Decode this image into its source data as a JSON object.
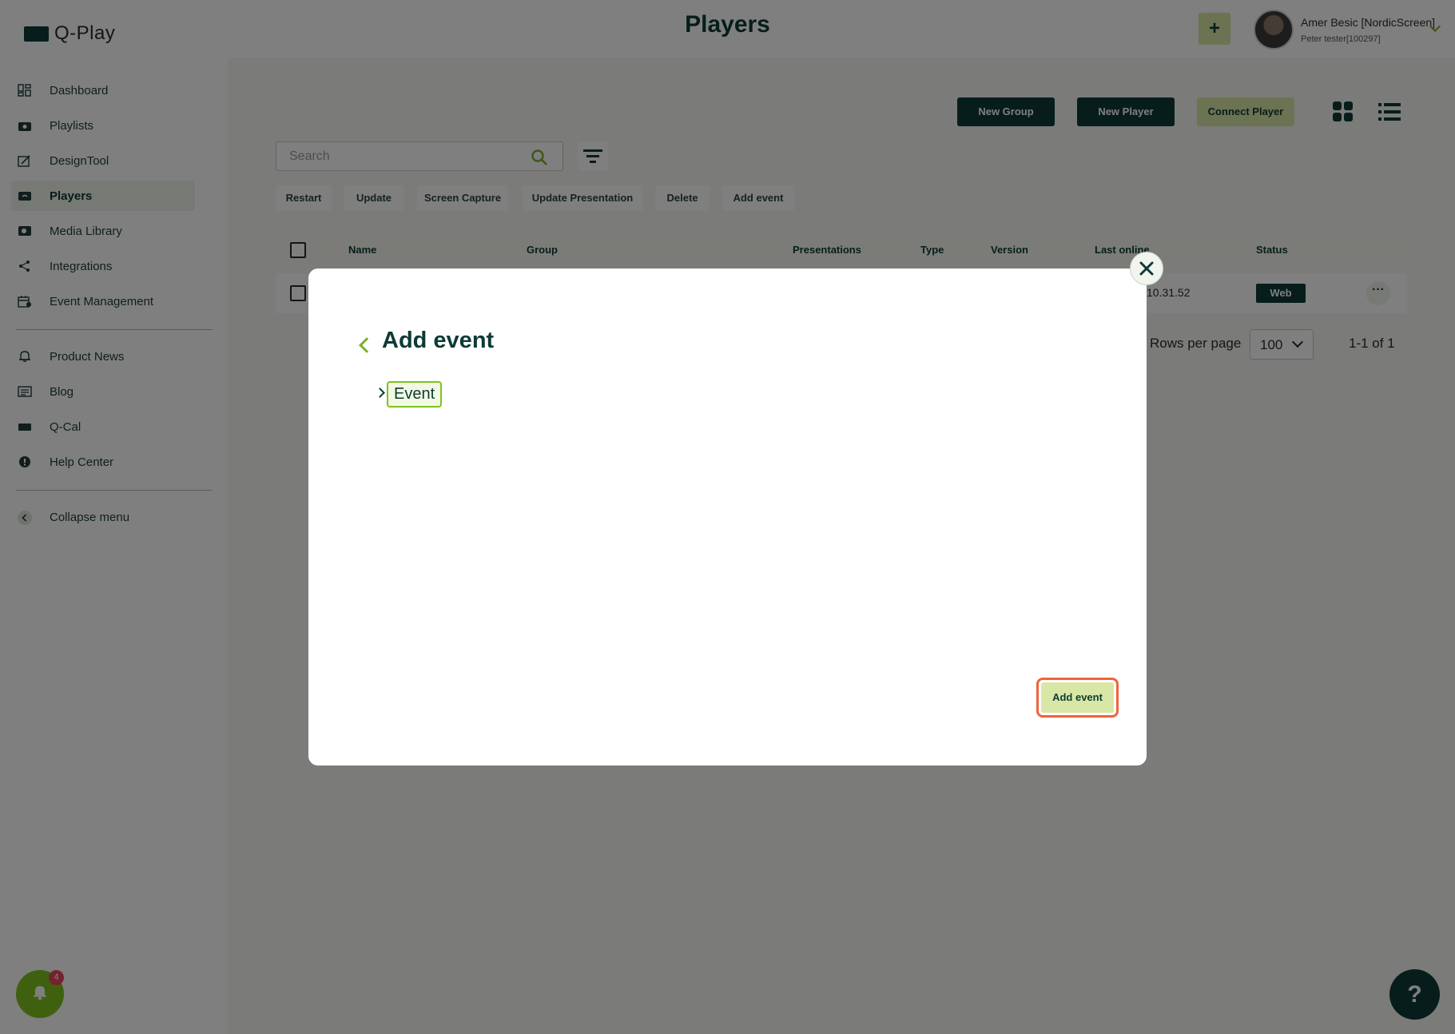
{
  "app": {
    "logo_text": "Q-Play"
  },
  "header": {
    "title": "Players",
    "plus_label": "+",
    "user": {
      "name": "Amer Besic [NordicScreen]",
      "account": "Peter tester[100297]"
    }
  },
  "sidebar": {
    "items": [
      {
        "label": "Dashboard",
        "icon": "dashboard-icon"
      },
      {
        "label": "Playlists",
        "icon": "playlists-icon"
      },
      {
        "label": "DesignTool",
        "icon": "designtool-icon"
      },
      {
        "label": "Players",
        "icon": "players-icon",
        "active": true
      },
      {
        "label": "Media Library",
        "icon": "media-library-icon"
      },
      {
        "label": "Integrations",
        "icon": "integrations-icon"
      },
      {
        "label": "Event Management",
        "icon": "event-management-icon"
      }
    ],
    "secondary": [
      {
        "label": "Product News",
        "icon": "product-news-icon"
      },
      {
        "label": "Blog",
        "icon": "blog-icon"
      },
      {
        "label": "Q-Cal",
        "icon": "qcal-icon"
      },
      {
        "label": "Help Center",
        "icon": "help-center-icon"
      }
    ],
    "collapse_label": "Collapse menu",
    "notification_count": "4"
  },
  "toolbar": {
    "new_group": "New Group",
    "new_player": "New Player",
    "connect_player": "Connect Player"
  },
  "search": {
    "placeholder": "Search"
  },
  "actions": [
    "Restart",
    "Update",
    "Screen Capture",
    "Update Presentation",
    "Delete",
    "Add event"
  ],
  "table": {
    "columns": [
      "Name",
      "Group",
      "Presentations",
      "Type",
      "Version",
      "Last online",
      "Status"
    ],
    "rows": [
      {
        "last_online_visible": "10.31.52",
        "status": "Web"
      }
    ]
  },
  "pagination": {
    "rows_per_page_label": "Rows per page",
    "rows_per_page_value": "100",
    "range": "1-1 of 1"
  },
  "help_label": "?",
  "modal": {
    "title": "Add event",
    "tree": [
      {
        "label": "Event",
        "expanded": false,
        "selected": true
      }
    ],
    "submit_label": "Add event"
  },
  "colors": {
    "brand_dark": "#0c3b36",
    "brand_light": "#d9e7a6",
    "accent_green": "#7fc21f",
    "highlight_orange": "#f0643c",
    "badge_red": "#e8445c"
  }
}
